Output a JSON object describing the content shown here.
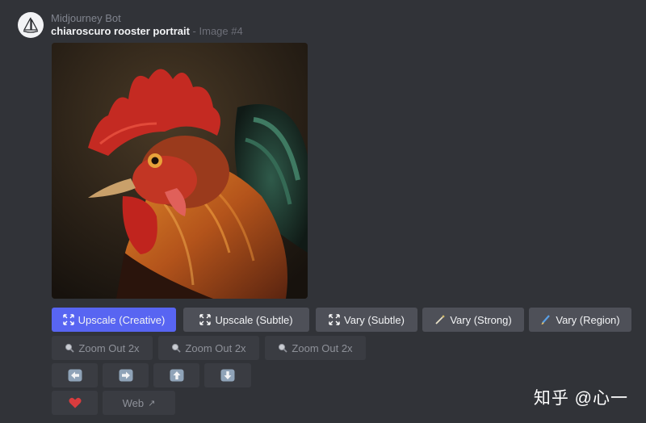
{
  "message": {
    "author": "Midjourney Bot",
    "prompt": "chiaroscuro rooster portrait",
    "separator": " - ",
    "image_label": "Image #4"
  },
  "image": {
    "subject": "rooster portrait",
    "icon": "rooster-image"
  },
  "buttons": {
    "row1": [
      {
        "label": "Upscale (Creative)",
        "icon": "expand-arrows-icon",
        "style": "primary"
      },
      {
        "label": "Upscale (Subtle)",
        "icon": "expand-arrows-icon",
        "style": "secondary"
      },
      {
        "label": "Vary (Subtle)",
        "icon": "expand-arrows-icon",
        "style": "secondary"
      },
      {
        "label": "Vary (Strong)",
        "icon": "magic-wand-icon",
        "style": "secondary"
      },
      {
        "label": "Vary (Region)",
        "icon": "paintbrush-icon",
        "style": "secondary"
      }
    ],
    "row2": [
      {
        "label": "Zoom Out 2x",
        "icon": "magnifier-icon",
        "style": "disabled"
      },
      {
        "label": "Zoom Out 2x",
        "icon": "magnifier-icon",
        "style": "disabled"
      },
      {
        "label": "Zoom Out 2x",
        "icon": "magnifier-icon",
        "style": "disabled"
      }
    ],
    "row3": [
      {
        "icon": "arrow-left-icon",
        "style": "disabled"
      },
      {
        "icon": "arrow-right-icon",
        "style": "disabled"
      },
      {
        "icon": "arrow-up-icon",
        "style": "disabled"
      },
      {
        "icon": "arrow-down-icon",
        "style": "disabled"
      }
    ],
    "row4": [
      {
        "icon": "heart-icon",
        "style": "disabled"
      },
      {
        "label": "Web",
        "link_glyph": "↗",
        "style": "disabled"
      }
    ]
  },
  "watermark": {
    "text": "知乎 @心一"
  },
  "colors": {
    "background": "#313338",
    "primary_button": "#5865f2",
    "secondary_button": "#4e5058",
    "disabled_button": "#3a3c42",
    "heart": "#d83c3e"
  }
}
